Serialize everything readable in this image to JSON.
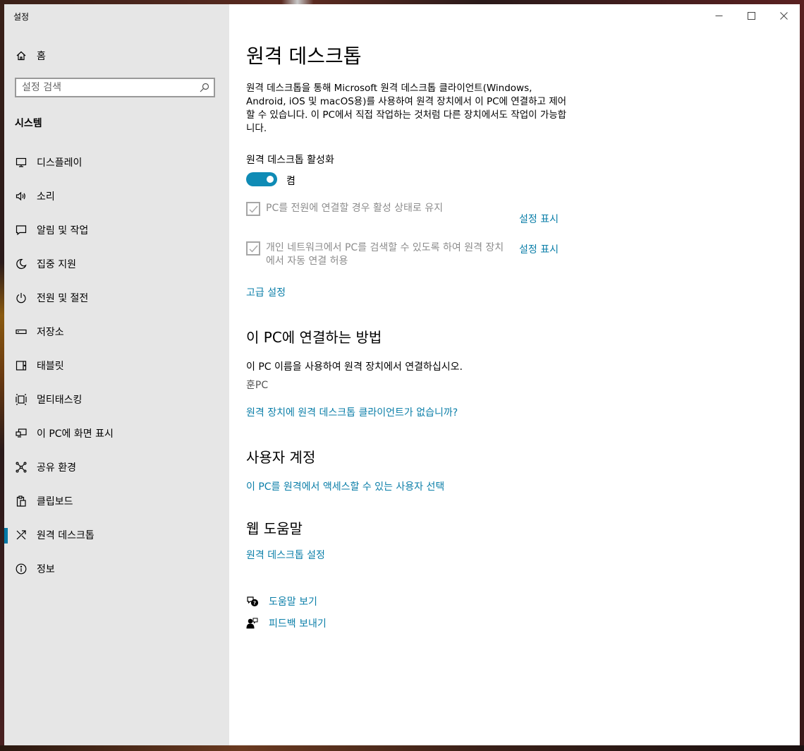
{
  "window": {
    "app_title": "설정",
    "controls": {
      "minimize": "minimize",
      "maximize": "maximize",
      "close": "close"
    }
  },
  "sidebar": {
    "home_label": "홈",
    "search_placeholder": "설정 검색",
    "section_title": "시스템",
    "items": [
      {
        "label": "디스플레이",
        "icon": "display-icon"
      },
      {
        "label": "소리",
        "icon": "speaker-icon"
      },
      {
        "label": "알림 및 작업",
        "icon": "notification-icon"
      },
      {
        "label": "집중 지원",
        "icon": "moon-icon"
      },
      {
        "label": "전원 및 절전",
        "icon": "power-icon"
      },
      {
        "label": "저장소",
        "icon": "storage-icon"
      },
      {
        "label": "태블릿",
        "icon": "tablet-icon"
      },
      {
        "label": "멀티태스킹",
        "icon": "multitasking-icon"
      },
      {
        "label": "이 PC에 화면 표시",
        "icon": "project-icon"
      },
      {
        "label": "공유 환경",
        "icon": "shared-experiences-icon"
      },
      {
        "label": "클립보드",
        "icon": "clipboard-icon"
      },
      {
        "label": "원격 데스크톱",
        "icon": "remote-desktop-icon",
        "active": true
      },
      {
        "label": "정보",
        "icon": "info-icon"
      }
    ]
  },
  "main": {
    "title": "원격 데스크톱",
    "description": "원격 데스크톱을 통해 Microsoft 원격 데스크톱 클라이언트(Windows, Android, iOS 및 macOS용)를 사용하여 원격 장치에서 이 PC에 연결하고 제어할 수 있습니다. 이 PC에서 직접 작업하는 것처럼 다른 장치에서도 작업이 가능합니다.",
    "enable_label": "원격 데스크톱 활성화",
    "toggle_state": "켬",
    "toggle_on": true,
    "checkbox_keep_awake": "PC를 전원에 연결할 경우 활성 상태로 유지",
    "checkbox_discoverable": "개인 네트워크에서 PC를 검색할 수 있도록 하여 원격 장치에서 자동 연결 허용",
    "show_settings_1": "설정 표시",
    "show_settings_2": "설정 표시",
    "advanced_settings": "고급 설정",
    "connect_heading": "이 PC에 연결하는 방법",
    "connect_text": "이 PC 이름을 사용하여 원격 장치에서 연결하십시오.",
    "pc_name": "훈PC",
    "no_client_link": "원격 장치에 원격 데스크톱 클라이언트가 없습니까?",
    "accounts_heading": "사용자 계정",
    "accounts_link": "이 PC를 원격에서 액세스할 수 있는 사용자 선택",
    "web_help_heading": "웹 도움말",
    "web_help_link": "원격 데스크톱 설정",
    "get_help": "도움말 보기",
    "give_feedback": "피드백 보내기"
  },
  "colors": {
    "accent": "#0a7ea8",
    "toggle": "#0f8bb5",
    "sidebar_bg": "#e6e6e6",
    "disabled_text": "#8c8c8c"
  }
}
